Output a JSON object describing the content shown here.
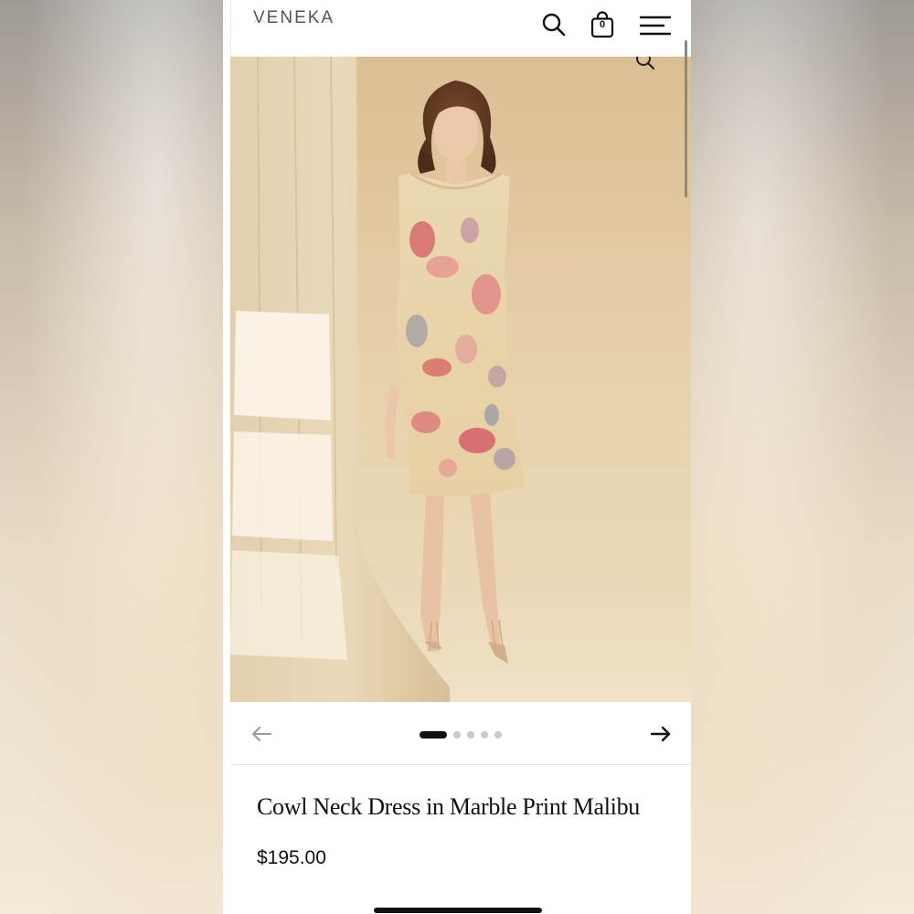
{
  "header": {
    "logo": "VENEKA",
    "bag_count": "0",
    "icons": [
      "search-icon",
      "shopping-bag-icon",
      "menu-icon"
    ]
  },
  "gallery": {
    "slide_count": 5,
    "active_index": 0,
    "icons": [
      "zoom-icon",
      "arrow-left-icon",
      "arrow-right-icon"
    ]
  },
  "product": {
    "title": "Cowl Neck Dress in Marble Print Malibu",
    "price": "$195.00"
  },
  "colors": {
    "background": "#ffffff",
    "text": "#111111",
    "dot_inactive": "#c9c9c9",
    "photo_backdrop": "#e6cfa8"
  }
}
